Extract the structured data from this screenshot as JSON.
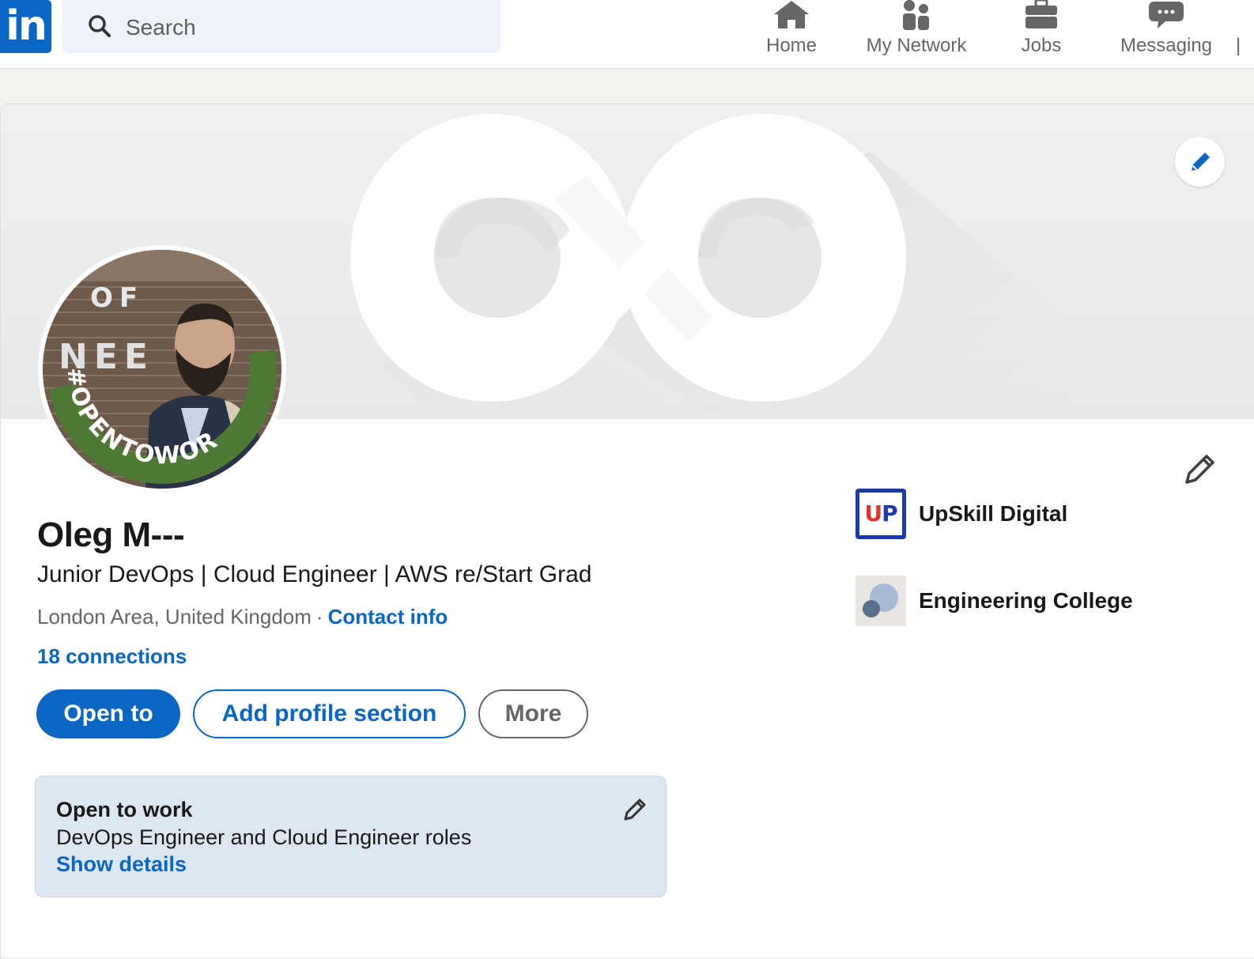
{
  "topbar": {
    "logo_text": "in",
    "search_placeholder": "Search",
    "nav": [
      {
        "label": "Home",
        "icon": "home-icon"
      },
      {
        "label": "My Network",
        "icon": "people-icon"
      },
      {
        "label": "Jobs",
        "icon": "briefcase-icon"
      },
      {
        "label": "Messaging",
        "icon": "chat-icon"
      }
    ]
  },
  "profile": {
    "name": "Oleg M---",
    "headline": "Junior DevOps | Cloud Engineer | AWS re/Start Grad",
    "location": "London Area, United Kingdom",
    "separator": "·",
    "contact_info": "Contact info",
    "connections": "18 connections",
    "avatar_frame_text": "#OPENTOWORK",
    "avatar_background_text": "OF NEE",
    "buttons": {
      "open_to": "Open to",
      "add_section": "Add profile section",
      "more": "More"
    }
  },
  "open_to_work": {
    "title": "Open to work",
    "description": "DevOps Engineer and Cloud Engineer roles",
    "link": "Show details"
  },
  "organizations": [
    {
      "name": "UpSkill Digital",
      "logo_text_a": "U",
      "logo_text_b": "P"
    },
    {
      "name": "Engineering College"
    }
  ],
  "colors": {
    "brand": "#0a66c2",
    "open_to_work_green": "#4e7a35",
    "card_bg": "#dde7f1"
  }
}
